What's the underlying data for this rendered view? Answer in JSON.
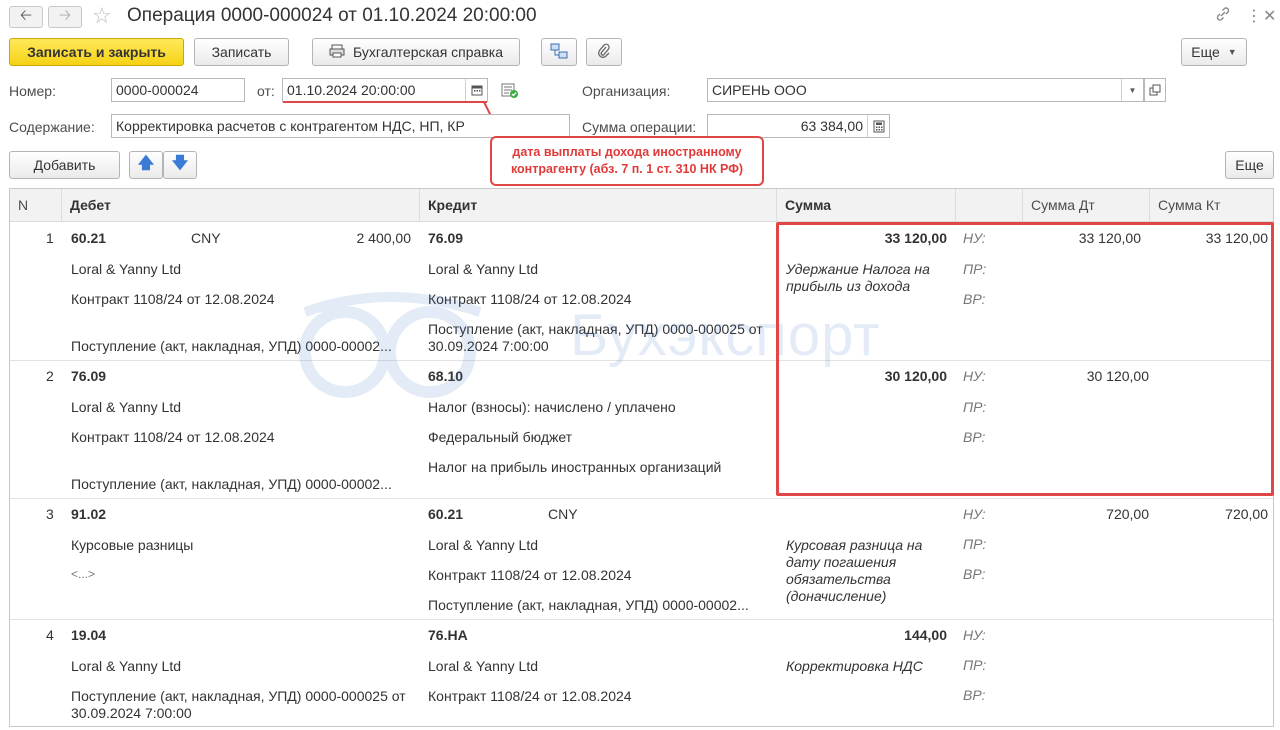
{
  "window": {
    "title": "Операция 0000-000024 от 01.10.2024 20:00:00"
  },
  "toolbar": {
    "save_close": "Записать и закрыть",
    "save": "Записать",
    "accounting_note": "Бухгалтерская справка",
    "more": "Еще"
  },
  "form": {
    "number_label": "Номер:",
    "number_value": "0000-000024",
    "from_label": "от:",
    "date_value": "01.10.2024 20:00:00",
    "org_label": "Организация:",
    "org_value": "СИРЕНЬ ООО",
    "content_label": "Содержание:",
    "content_value": "Корректировка расчетов с контрагентом НДС, НП, КР",
    "sum_label": "Сумма операции:",
    "sum_value": "63 384,00"
  },
  "callout": {
    "line1": "дата выплаты дохода иностранному",
    "line2": "контрагенту (абз. 7 п. 1 ст. 310 НК РФ)"
  },
  "table_toolbar": {
    "add": "Добавить",
    "more": "Еще"
  },
  "table": {
    "headers": [
      "N",
      "Дебет",
      "Кредит",
      "Сумма",
      "",
      "Сумма Дт",
      "Сумма Кт"
    ],
    "rows": [
      {
        "n": "1",
        "debit": [
          "60.21",
          "Loral & Yanny Ltd",
          "Контракт 1108/24 от 12.08.2024",
          "Поступление (акт, накладная, УПД) 0000-00002..."
        ],
        "debit_currency": "CNY",
        "debit_currency_amount": "2 400,00",
        "credit": [
          "76.09",
          "Loral & Yanny Ltd",
          "Контракт 1108/24 от 12.08.2024",
          "Поступление (акт, накладная, УПД) 0000-000025 от 30.09.2024 7:00:00"
        ],
        "sum": "33 120,00",
        "content": "Удержание Налога на прибыль из дохода",
        "nu": "НУ:",
        "pr": "ПР:",
        "vr": "ВР:",
        "sum_dt": "33 120,00",
        "sum_kt": "33 120,00"
      },
      {
        "n": "2",
        "debit": [
          "76.09",
          "Loral & Yanny Ltd",
          "Контракт 1108/24 от 12.08.2024",
          "Поступление (акт, накладная, УПД) 0000-00002..."
        ],
        "credit": [
          "68.10",
          "Налог (взносы): начислено / уплачено",
          "Федеральный бюджет",
          "Налог на прибыль иностранных организаций"
        ],
        "sum": "30 120,00",
        "nu": "НУ:",
        "pr": "ПР:",
        "vr": "ВР:",
        "sum_dt": "30 120,00"
      },
      {
        "n": "3",
        "debit": [
          "91.02",
          "Курсовые разницы",
          "<...>"
        ],
        "credit": [
          "60.21",
          "Loral & Yanny Ltd",
          "Контракт 1108/24 от 12.08.2024",
          "Поступление (акт, накладная, УПД) 0000-00002..."
        ],
        "credit_currency": "CNY",
        "content": "Курсовая разница на дату погашения обязательства (доначисление)",
        "nu": "НУ:",
        "pr": "ПР:",
        "vr": "ВР:",
        "sum_dt": "720,00",
        "sum_kt": "720,00"
      },
      {
        "n": "4",
        "debit": [
          "19.04",
          "Loral & Yanny Ltd",
          "Поступление (акт, накладная, УПД) 0000-000025 от 30.09.2024 7:00:00"
        ],
        "credit": [
          "76.НА",
          "Loral & Yanny Ltd",
          "Контракт 1108/24 от 12.08.2024"
        ],
        "sum": "144,00",
        "content": "Корректировка НДС",
        "nu": "НУ:",
        "pr": "ПР:",
        "vr": "ВР:"
      }
    ]
  },
  "watermark": {
    "text": "Бухэкспорт"
  },
  "colors": {
    "primary_button": "#f6d215",
    "highlight": "#e04646",
    "accent_blue": "#3a7bd5"
  },
  "icons": [
    "back-arrow-icon",
    "forward-arrow-icon",
    "star-icon",
    "link-icon",
    "more-vertical-icon",
    "close-icon",
    "print-icon",
    "structure-icon",
    "paperclip-icon",
    "calendar-icon",
    "document-check-icon",
    "dropdown-arrow-icon",
    "open-icon",
    "calculator-icon",
    "arrow-up-icon",
    "arrow-down-icon"
  ]
}
